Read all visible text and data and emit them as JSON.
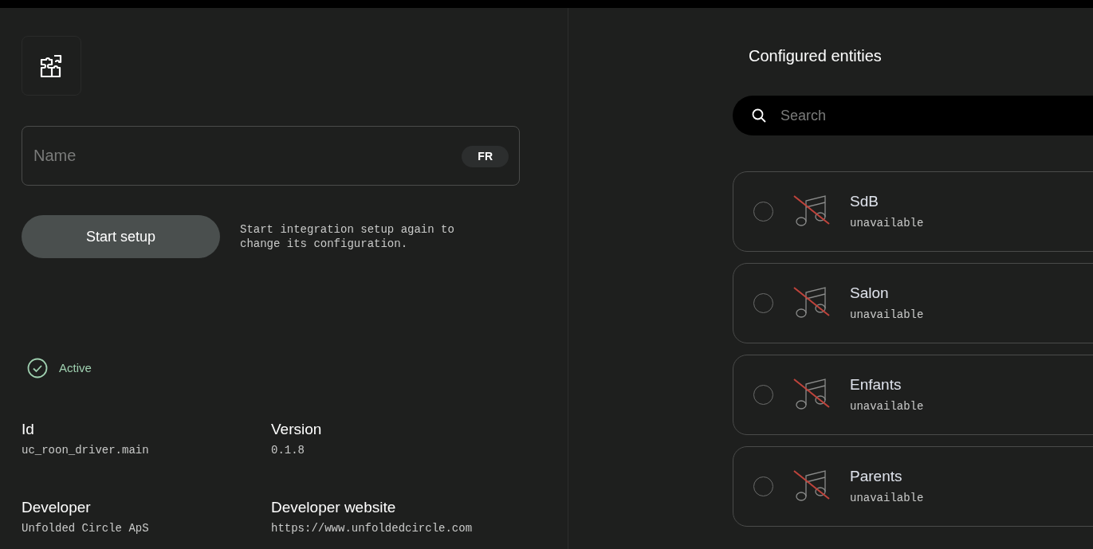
{
  "integration": {
    "name_field": {
      "placeholder": "Name",
      "language": "FR"
    },
    "setup_button": "Start setup",
    "setup_hint": "Start integration setup again to change its configuration.",
    "status": {
      "label": "Active",
      "active": true
    },
    "details": [
      {
        "label": "Id",
        "value": "uc_roon_driver.main"
      },
      {
        "label": "Version",
        "value": "0.1.8"
      },
      {
        "label": "Developer",
        "value": "Unfolded Circle ApS"
      },
      {
        "label": "Developer website",
        "value": "https://www.unfoldedcircle.com"
      }
    ]
  },
  "entities": {
    "title": "Configured entities",
    "search": {
      "placeholder": "Search"
    },
    "items": [
      {
        "name": "SdB",
        "state": "unavailable",
        "selected": false
      },
      {
        "name": "Salon",
        "state": "unavailable",
        "selected": false
      },
      {
        "name": "Enfants",
        "state": "unavailable",
        "selected": false
      },
      {
        "name": "Parents",
        "state": "unavailable",
        "selected": false
      }
    ]
  }
}
